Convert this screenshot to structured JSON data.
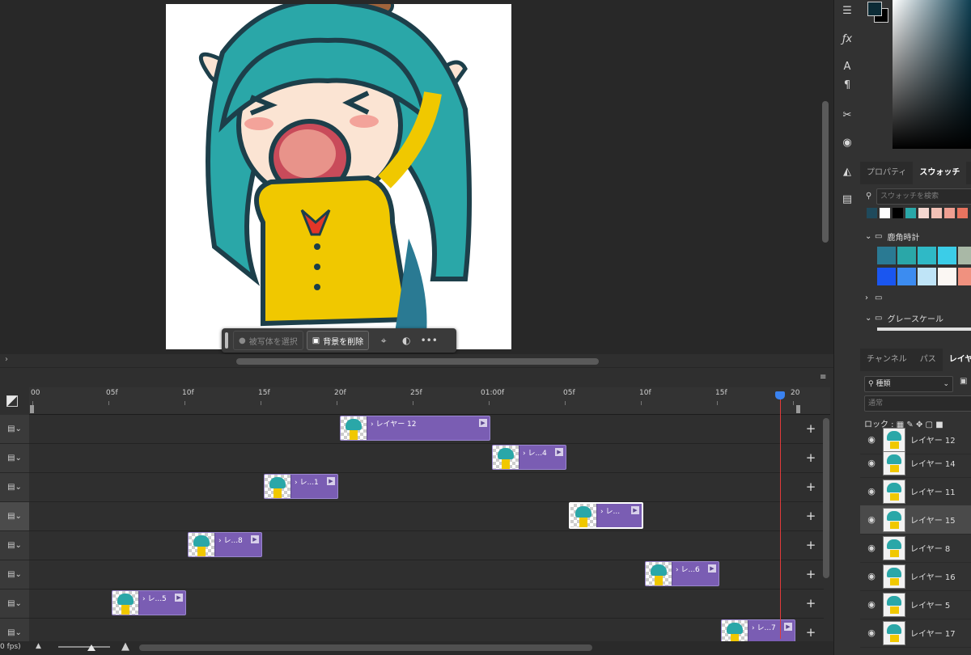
{
  "task_bar": {
    "select_subject_label": "被写体を選択",
    "remove_background_label": "背景を削除"
  },
  "panels": {
    "properties_tab": "プロパティ",
    "swatches_tab": "スウォッチ",
    "swatch_search_placeholder": "スウォッチを検索",
    "group_1": "鹿角時計",
    "group_3": "グレースケール",
    "channels_tab": "チャンネル",
    "paths_tab": "パス",
    "layers_tab": "レイヤ",
    "filter_kind": "種類",
    "blend_mode": "通常",
    "lock_label": "ロック :",
    "recent_swatches": [
      "#1f4a5c",
      "#ffffff",
      "#000000",
      "#2aa7a8",
      "#f3d6cf",
      "#f2c1b6",
      "#ef9f92",
      "#e8735f"
    ],
    "group_swatches": [
      "#2a7a93",
      "#2aa7a8",
      "#2fb9c6",
      "#3bcde8",
      "#a9b8a6",
      "#1a56f0",
      "#3c8cf0",
      "#bfe4f7",
      "#fbf7f3",
      "#f0917f"
    ],
    "foreground_color": "#0c2b36",
    "background_color": "#000000"
  },
  "layers": [
    {
      "name": "レイヤー 12"
    },
    {
      "name": "レイヤー 14"
    },
    {
      "name": "レイヤー 11"
    },
    {
      "name": "レイヤー 15"
    },
    {
      "name": "レイヤー 8"
    },
    {
      "name": "レイヤー 16"
    },
    {
      "name": "レイヤー 5"
    },
    {
      "name": "レイヤー 17"
    }
  ],
  "timeline": {
    "ruler": [
      "00",
      "05f",
      "10f",
      "15f",
      "20f",
      "25f",
      "01:00f",
      "05f",
      "10f",
      "15f",
      "20"
    ],
    "fps_label": "0 fps)",
    "clips": [
      {
        "label": "レイヤー 12"
      },
      {
        "label": "レ...4"
      },
      {
        "label": "レ...1"
      },
      {
        "label": "レ..."
      },
      {
        "label": "レ...8"
      },
      {
        "label": "レ...6"
      },
      {
        "label": "レ...5"
      },
      {
        "label": "レ...7"
      }
    ]
  }
}
